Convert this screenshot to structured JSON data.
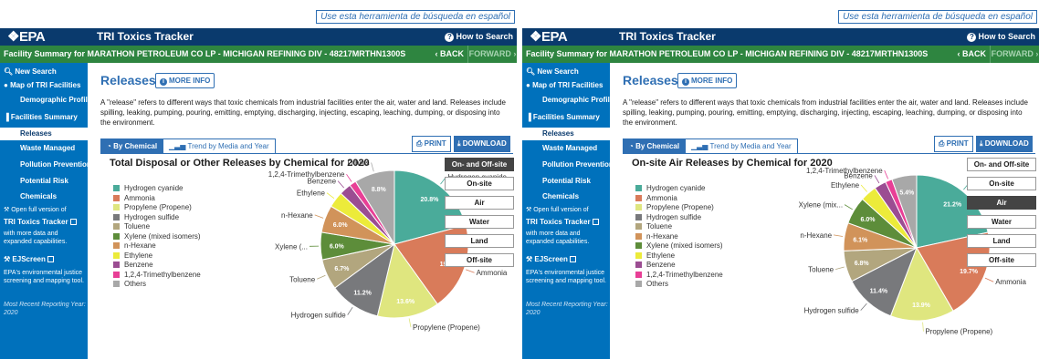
{
  "panels": [
    {
      "spanish_link": "Use esta herramienta de búsqueda en español",
      "logo": "❖EPA",
      "app_title": "TRI Toxics Tracker",
      "how_to": "How to Search",
      "facility_bar": "Facility Summary for MARATHON PETROLEUM CO LP - MICHIGAN REFINING DIV - 48217MRTHN1300S",
      "back": "BACK",
      "forward": "FORWARD",
      "sidebar": {
        "new_search": "New Search",
        "map": "Map of TRI Facilities",
        "demographic": "Demographic Profile",
        "facilities_summary": "Facilities Summary",
        "releases": "Releases",
        "waste": "Waste Managed",
        "pollution": "Pollution Prevention",
        "risk": "Potential Risk",
        "chemicals": "Chemicals",
        "open_full": "Open full version of",
        "full_link": "TRI Toxics Tracker",
        "full_desc": "with more data and expanded capabilities.",
        "ejscreen": "EJScreen",
        "ej_desc": "EPA's environmental justice screening and mapping tool.",
        "recent": "Most Recent Reporting Year: 2020"
      },
      "releases_title": "Releases",
      "more_info": "MORE INFO",
      "description": "A \"release\" refers to different ways that toxic chemicals from industrial facilities enter the air, water and land. Releases include spilling, leaking, pumping, pouring, emitting, emptying, discharging, injecting, escaping, leaching, dumping, or disposing into the environment.",
      "tab_chemical": "By Chemical",
      "tab_trend": "Trend by Media and Year",
      "print": "PRINT",
      "download": "DOWNLOAD",
      "filters": [
        "On- and Off-site",
        "On-site",
        "Air",
        "Water",
        "Land",
        "Off-site"
      ],
      "selected_filter": 0
    },
    {
      "spanish_link": "Use esta herramienta de búsqueda en español",
      "logo": "❖EPA",
      "app_title": "TRI Toxics Tracker",
      "how_to": "How to Search",
      "facility_bar": "Facility Summary for MARATHON PETROLEUM CO LP - MICHIGAN REFINING DIV - 48217MRTHN1300S",
      "back": "BACK",
      "forward": "FORWARD",
      "sidebar": {
        "new_search": "New Search",
        "map": "Map of TRI Facilities",
        "demographic": "Demographic Profile",
        "facilities_summary": "Facilities Summary",
        "releases": "Releases",
        "waste": "Waste Managed",
        "pollution": "Pollution Prevention",
        "risk": "Potential Risk",
        "chemicals": "Chemicals",
        "open_full": "Open full version of",
        "full_link": "TRI Toxics Tracker",
        "full_desc": "with more data and expanded capabilities.",
        "ejscreen": "EJScreen",
        "ej_desc": "EPA's environmental justice screening and mapping tool.",
        "recent": "Most Recent Reporting Year: 2020"
      },
      "releases_title": "Releases",
      "more_info": "MORE INFO",
      "description": "A \"release\" refers to different ways that toxic chemicals from industrial facilities enter the air, water and land. Releases include spilling, leaking, pumping, pouring, emitting, emptying, discharging, injecting, escaping, leaching, dumping, or disposing into the environment.",
      "tab_chemical": "By Chemical",
      "tab_trend": "Trend by Media and Year",
      "print": "PRINT",
      "download": "DOWNLOAD",
      "filters": [
        "On- and Off-site",
        "On-site",
        "Air",
        "Water",
        "Land",
        "Off-site"
      ],
      "selected_filter": 2
    }
  ],
  "chart_data": [
    {
      "type": "pie",
      "title": "Total Disposal or Other Releases by Chemical for 2020",
      "series": [
        {
          "name": "Hydrogen cyanide",
          "value": 20.8,
          "color": "#4aab9a",
          "label": "Hydrogen cyanide",
          "pct": "20.8%"
        },
        {
          "name": "Ammonia",
          "value": 19.3,
          "color": "#d97b5a",
          "label": "Ammonia",
          "pct": "19.3%"
        },
        {
          "name": "Propylene (Propene)",
          "value": 13.6,
          "color": "#dfe67f",
          "label": "Propylene (Propene)",
          "pct": "13.6%"
        },
        {
          "name": "Hydrogen sulfide",
          "value": 11.2,
          "color": "#78797c",
          "label": "Hydrogen sulfide",
          "pct": "11.2%"
        },
        {
          "name": "Toluene",
          "value": 6.7,
          "color": "#b2a67e",
          "label": "Toluene",
          "pct": "6.7%"
        },
        {
          "name": "Xylene (mixed isomers)",
          "value": 6.0,
          "color": "#5d8d3a",
          "label": "Xylene (...",
          "pct": "6.0%"
        },
        {
          "name": "n-Hexane",
          "value": 6.0,
          "color": "#d1935a",
          "label": "n-Hexane",
          "pct": "6.0%"
        },
        {
          "name": "Ethylene",
          "value": 3.5,
          "color": "#eceb3a",
          "label": "Ethylene",
          "pct": ""
        },
        {
          "name": "Benzene",
          "value": 2.6,
          "color": "#9b4d92",
          "label": "Benzene",
          "pct": ""
        },
        {
          "name": "1,2,4-Trimethylbenzene",
          "value": 1.5,
          "color": "#e83f96",
          "label": "1,2,4-Trimethylbenzene",
          "pct": ""
        },
        {
          "name": "Others",
          "value": 8.8,
          "color": "#a8a8a8",
          "label": "Others",
          "pct": "8.8%"
        }
      ],
      "legend_order": [
        "Hydrogen cyanide",
        "Ammonia",
        "Propylene (Propene)",
        "Hydrogen sulfide",
        "Toluene",
        "Xylene (mixed isomers)",
        "n-Hexane",
        "Ethylene",
        "Benzene",
        "1,2,4-Trimethylbenzene",
        "Others"
      ]
    },
    {
      "type": "pie",
      "title": "On-site Air Releases by Chemical for 2020",
      "series": [
        {
          "name": "Hydrogen cyanide",
          "value": 21.2,
          "color": "#4aab9a",
          "label": "Hydrogen cyanide",
          "pct": "21.2%"
        },
        {
          "name": "Ammonia",
          "value": 19.7,
          "color": "#d97b5a",
          "label": "Ammonia",
          "pct": "19.7%"
        },
        {
          "name": "Propylene (Propene)",
          "value": 13.9,
          "color": "#dfe67f",
          "label": "Propylene (Propene)",
          "pct": "13.9%"
        },
        {
          "name": "Hydrogen sulfide",
          "value": 11.4,
          "color": "#78797c",
          "label": "Hydrogen sulfide",
          "pct": "11.4%"
        },
        {
          "name": "Toluene",
          "value": 6.8,
          "color": "#b2a67e",
          "label": "Toluene",
          "pct": "6.8%"
        },
        {
          "name": "n-Hexane",
          "value": 6.1,
          "color": "#d1935a",
          "label": "n-Hexane",
          "pct": "6.1%"
        },
        {
          "name": "Xylene (mixed isomers)",
          "value": 6.0,
          "color": "#5d8d3a",
          "label": "Xylene (mix...",
          "pct": "6.0%"
        },
        {
          "name": "Ethylene",
          "value": 3.6,
          "color": "#eceb3a",
          "label": "Ethylene",
          "pct": ""
        },
        {
          "name": "Benzene",
          "value": 2.6,
          "color": "#9b4d92",
          "label": "Benzene",
          "pct": ""
        },
        {
          "name": "1,2,4-Trimethylbenzene",
          "value": 1.5,
          "color": "#e83f96",
          "label": "1,2,4-Trimethylbenzene",
          "pct": ""
        },
        {
          "name": "Others",
          "value": 5.4,
          "color": "#a8a8a8",
          "label": "",
          "pct": "5.4%"
        }
      ],
      "legend_order": [
        "Hydrogen cyanide",
        "Ammonia",
        "Propylene (Propene)",
        "Hydrogen sulfide",
        "Toluene",
        "n-Hexane",
        "Xylene (mixed isomers)",
        "Ethylene",
        "Benzene",
        "1,2,4-Trimethylbenzene",
        "Others"
      ]
    }
  ]
}
